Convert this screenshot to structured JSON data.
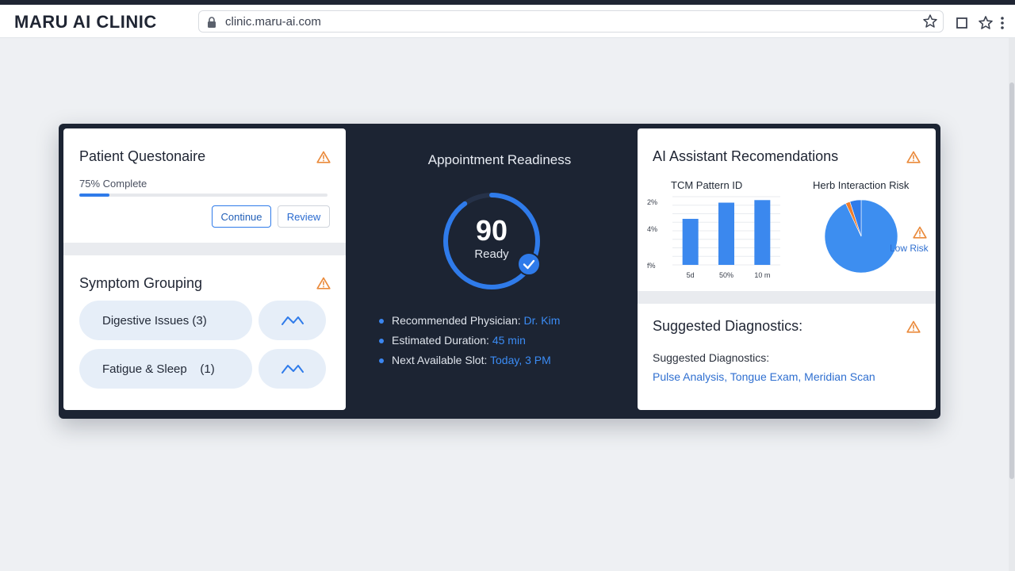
{
  "browser": {
    "brand": "MARU AI CLINIC",
    "url": "clinic.maru-ai.com"
  },
  "questionnaire": {
    "title": "Patient Questonaire",
    "progress_label": "75% Complete",
    "progress_fraction": 0.12,
    "continue_label": "Continue",
    "review_label": "Review"
  },
  "symptoms": {
    "title": "Symptom Grouping",
    "groups": [
      {
        "label": "Digestive Issues (3)",
        "icon": "trend-icon"
      },
      {
        "label": "Fatigue & Sleep    (1)",
        "icon": "trend-icon"
      }
    ]
  },
  "readiness": {
    "title": "Appointment Readiness",
    "score": "90",
    "score_label": "Ready",
    "score_fraction": 0.9,
    "details": [
      {
        "label": "Recommended Physician: ",
        "value": "Dr. Kim"
      },
      {
        "label": "Estimated Duration: ",
        "value": "45 min"
      },
      {
        "label": "Next Available Slot: ",
        "value": "Today, 3 PM"
      }
    ]
  },
  "ai_recommendations": {
    "title": "AI Assistant Recomendations",
    "risk_title": "Herb Interaction Risk",
    "risk_label": "Low Risk"
  },
  "diagnostics": {
    "title": "Suggested Diagnostics:",
    "subtitle": "Suggested Diagnostics:",
    "values": "Pulse Analysis, Tongue Exam, Meridian Scan"
  },
  "colors": {
    "accent": "#2f7bea",
    "warning": "#ea8a3b",
    "dashboard_bg": "#1c2433",
    "pie_secondary": "#ef7d2c"
  },
  "chart_data": [
    {
      "type": "bar",
      "title": "TCM Pattern ID",
      "categories": [
        "5d",
        "50%",
        "10 m"
      ],
      "values": [
        5.4,
        7.3,
        7.6
      ],
      "ytick_labels": [
        "2%",
        "4%",
        "f%"
      ],
      "ylim": [
        0,
        8
      ],
      "grid": true
    },
    {
      "type": "pie",
      "title": "Herb Interaction Risk",
      "slices": [
        {
          "name": "Low Risk",
          "value": 93,
          "color": "#3d8ef0"
        },
        {
          "name": "",
          "value": 2,
          "color": "#ef7d2c"
        },
        {
          "name": "",
          "value": 5,
          "color": "#2f7bea"
        }
      ]
    }
  ]
}
